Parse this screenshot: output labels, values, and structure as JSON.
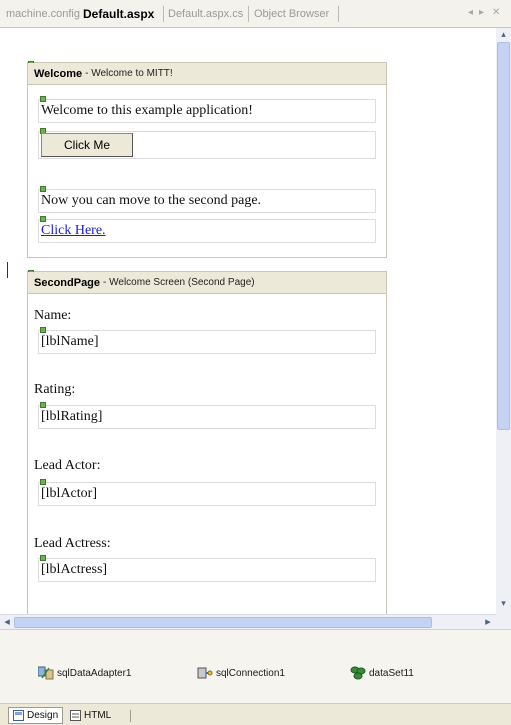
{
  "tabs": [
    {
      "label": "machine.config",
      "active": false
    },
    {
      "label": "Default.aspx",
      "active": true
    },
    {
      "label": "Default.aspx.cs",
      "active": false
    },
    {
      "label": "Object Browser",
      "active": false
    }
  ],
  "tab_nav": {
    "prev": "◂",
    "next": "▸",
    "close": "✕"
  },
  "welcome_control": {
    "name": "Welcome",
    "description": "- Welcome to MITT!",
    "welcome_text": "Welcome to this example application!",
    "button_label": "Click Me",
    "next_text": "Now you can move to the second page.",
    "link_text": "Click Here."
  },
  "second_page_control": {
    "name": "SecondPage",
    "description": "- Welcome Screen (Second Page)",
    "fields": [
      {
        "label": "Name:",
        "value": "[lblName]"
      },
      {
        "label": "Rating:",
        "value": "[lblRating]"
      },
      {
        "label": "Lead Actor:",
        "value": "[lblActor]"
      },
      {
        "label": "Lead Actress:",
        "value": "[lblActress]"
      }
    ]
  },
  "scrollbars": {
    "up": "▴",
    "down": "▾",
    "left": "◂",
    "right": "▸"
  },
  "tray": {
    "items": [
      {
        "label": "sqlDataAdapter1",
        "icon": "data-adapter-icon"
      },
      {
        "label": "sqlConnection1",
        "icon": "connection-icon"
      },
      {
        "label": "dataSet11",
        "icon": "dataset-icon"
      }
    ]
  },
  "views": [
    {
      "label": "Design",
      "active": true
    },
    {
      "label": "HTML",
      "active": false
    }
  ],
  "colors": {
    "header_bg": "#ece9d8",
    "link": "#1a1ae6",
    "scroll_thumb": "#c4d3f4"
  }
}
